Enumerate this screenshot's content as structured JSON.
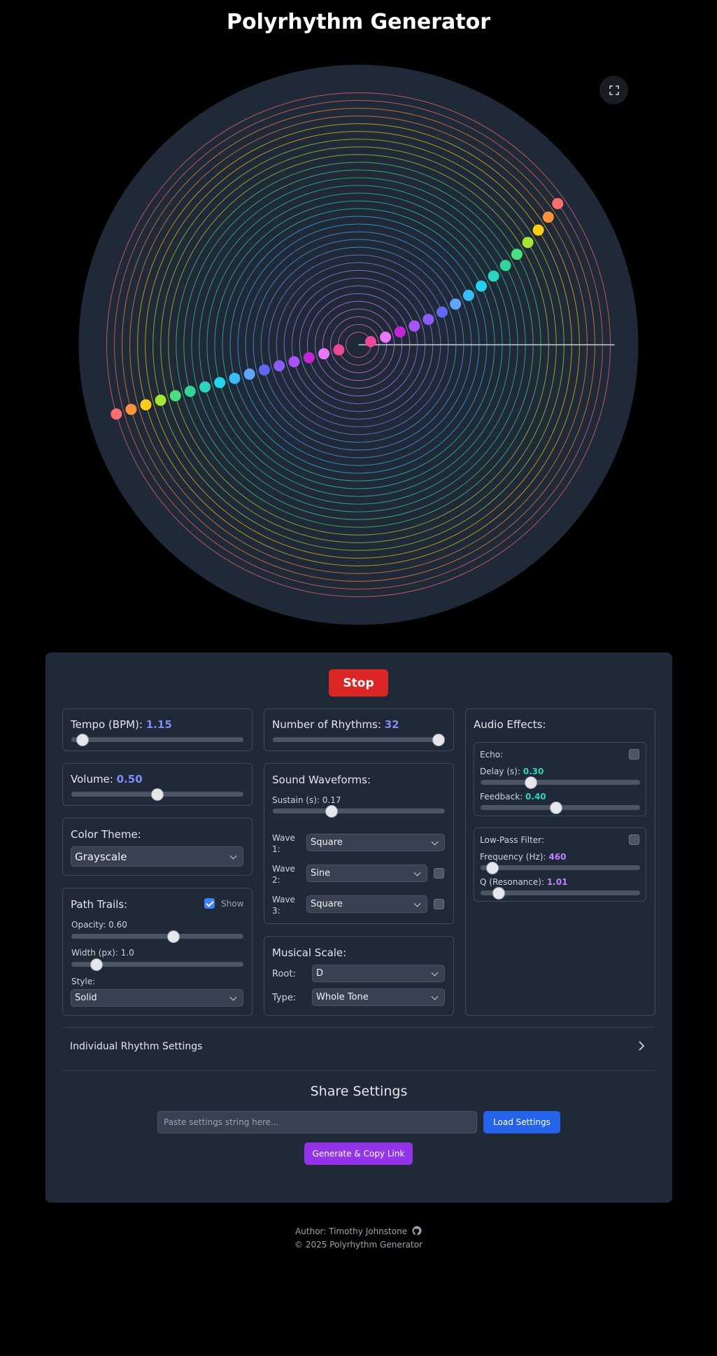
{
  "title": "Polyrhythm Generator",
  "visualization": {
    "rhythm_count": 32,
    "ring_colors": [
      "#f87171",
      "#fb923c",
      "#facc15",
      "#a3e635",
      "#4ade80",
      "#34d399",
      "#2dd4bf",
      "#38bdf8",
      "#60a5fa",
      "#818cf8",
      "#a78bfa",
      "#c084fc",
      "#e879f9",
      "#f472b6"
    ],
    "ring_stroke_opacity": 0.7,
    "dot_colors": [
      "#f87171",
      "#fb923c",
      "#facc15",
      "#a3e635",
      "#4ade80",
      "#34d399",
      "#2dd4bf",
      "#22d3ee",
      "#38bdf8",
      "#60a5fa",
      "#6366f1",
      "#8b5cf6",
      "#a855f7",
      "#c026d3",
      "#e879f9",
      "#ec4899"
    ],
    "background_color": "#1f2937",
    "fullscreen_icon": "expand-icon"
  },
  "controls": {
    "stop_label": "Stop",
    "tempo": {
      "label": "Tempo (BPM):",
      "value": "1.15",
      "level": 0.03
    },
    "volume": {
      "label": "Volume:",
      "value": "0.50",
      "level": 0.5
    },
    "color_theme": {
      "label": "Color Theme:",
      "selected": "Grayscale"
    },
    "path_trails": {
      "label": "Path Trails:",
      "show_label": "Show",
      "show_checked": true,
      "opacity_label": "Opacity:",
      "opacity_value": "0.60",
      "opacity_level": 0.6,
      "width_label": "Width (px):",
      "width_value": "1.0",
      "width_level": 0.12,
      "style_label": "Style:",
      "style_selected": "Solid"
    },
    "num_rhythms": {
      "label": "Number of Rhythms:",
      "value": "32",
      "level": 1.0
    },
    "waveforms": {
      "label": "Sound Waveforms:",
      "sustain_label": "Sustain (s):",
      "sustain_value": "0.17",
      "sustain_level": 0.33,
      "wave1_label": "Wave\n1:",
      "wave1_line1": "Wave",
      "wave1_line2": "1:",
      "wave1_value": "Square",
      "wave2_line1": "Wave",
      "wave2_line2": "2:",
      "wave2_value": "Sine",
      "wave3_line1": "Wave",
      "wave3_line2": "3:",
      "wave3_value": "Square"
    },
    "scale": {
      "label": "Musical Scale:",
      "root_label": "Root:",
      "root_value": "D",
      "type_label": "Type:",
      "type_value": "Whole Tone"
    },
    "audio_effects": {
      "label": "Audio Effects:",
      "echo_label": "Echo:",
      "delay_label": "Delay (s):",
      "delay_value": "0.30",
      "delay_level": 0.3,
      "feedback_label": "Feedback:",
      "feedback_value": "0.40",
      "feedback_level": 0.47,
      "lowpass_label": "Low-Pass Filter:",
      "freq_label": "Frequency (Hz):",
      "freq_value": "460",
      "freq_level": 0.04,
      "q_label": "Q (Resonance):",
      "q_value": "1.01",
      "q_level": 0.08
    },
    "individual_settings_label": "Individual Rhythm Settings"
  },
  "share": {
    "title": "Share Settings",
    "input_placeholder": "Paste settings string here...",
    "load_label": "Load Settings",
    "generate_label": "Generate & Copy Link"
  },
  "footer": {
    "author": "Author: Timothy Johnstone",
    "copyright": "© 2025 Polyrhythm Generator"
  }
}
